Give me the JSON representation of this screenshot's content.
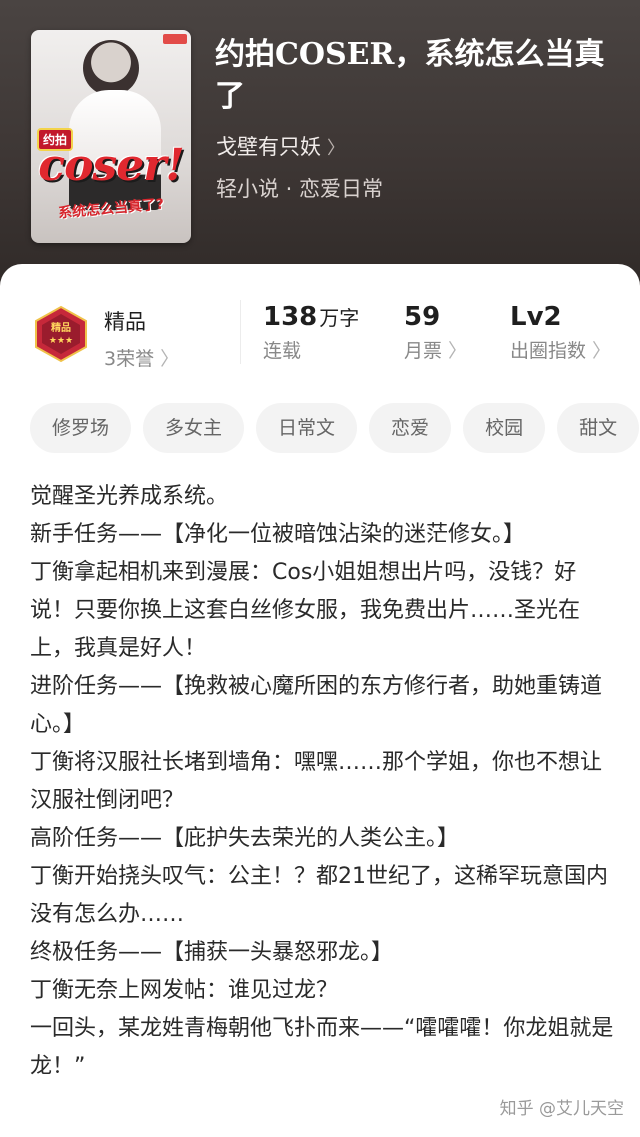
{
  "book": {
    "title": "约拍COSER，系统怎么当真了",
    "author": "戈壁有只妖",
    "genre": "轻小说 · 恋爱日常",
    "cover": {
      "badge": "约拍",
      "main": "coser!",
      "subtitle": "系统怎么当真了?"
    }
  },
  "stats": {
    "quality": {
      "label": "精品",
      "sub": "3荣誉"
    },
    "words": {
      "value": "138",
      "unit": "万字",
      "label": "连载"
    },
    "tickets": {
      "value": "59",
      "label": "月票"
    },
    "level": {
      "value": "Lv2",
      "label": "出圈指数"
    }
  },
  "tags": [
    "修罗场",
    "多女主",
    "日常文",
    "恋爱",
    "校园",
    "甜文"
  ],
  "description": [
    "觉醒圣光养成系统。",
    "新手任务——【净化一位被暗蚀沾染的迷茫修女。】",
    "丁衡拿起相机来到漫展：Cos小姐姐想出片吗，没钱？好说！只要你换上这套白丝修女服，我免费出片……圣光在上，我真是好人！",
    "进阶任务——【挽救被心魔所困的东方修行者，助她重铸道心。】",
    "丁衡将汉服社长堵到墙角：嘿嘿……那个学姐，你也不想让汉服社倒闭吧？",
    "高阶任务——【庇护失去荣光的人类公主。】",
    "丁衡开始挠头叹气：公主！？都21世纪了，这稀罕玩意国内没有怎么办……",
    "终极任务——【捕获一头暴怒邪龙。】",
    "丁衡无奈上网发帖：谁见过龙？",
    "一回头，某龙姓青梅朝他飞扑而来——“嚯嚯嚯！你龙姐就是龙！”"
  ],
  "watermark": "知乎 @艾儿天空",
  "icons": {
    "chevron": "chevron-right-icon",
    "medal": "quality-medal-icon"
  },
  "colors": {
    "hero_bg": "#3d3634",
    "tag_bg": "#f3f3f3",
    "medal_red": "#c6283a"
  }
}
